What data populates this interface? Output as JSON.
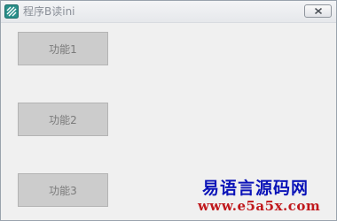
{
  "window": {
    "title": "程序B读ini",
    "app_icon": "app-icon"
  },
  "titlebar": {
    "close_icon": "close-icon"
  },
  "buttons": [
    {
      "label": "功能1"
    },
    {
      "label": "功能2"
    },
    {
      "label": "功能3"
    }
  ],
  "watermark": {
    "line1": "易语言源码网",
    "line2": "www.e5a5x.com"
  },
  "colors": {
    "window_bg": "#f0f0f0",
    "button_bg": "#cccccc",
    "button_text": "#7a7a7a",
    "title_text": "#8a8f98",
    "watermark_blue": "#0a13b8",
    "watermark_red": "#c0181c"
  }
}
